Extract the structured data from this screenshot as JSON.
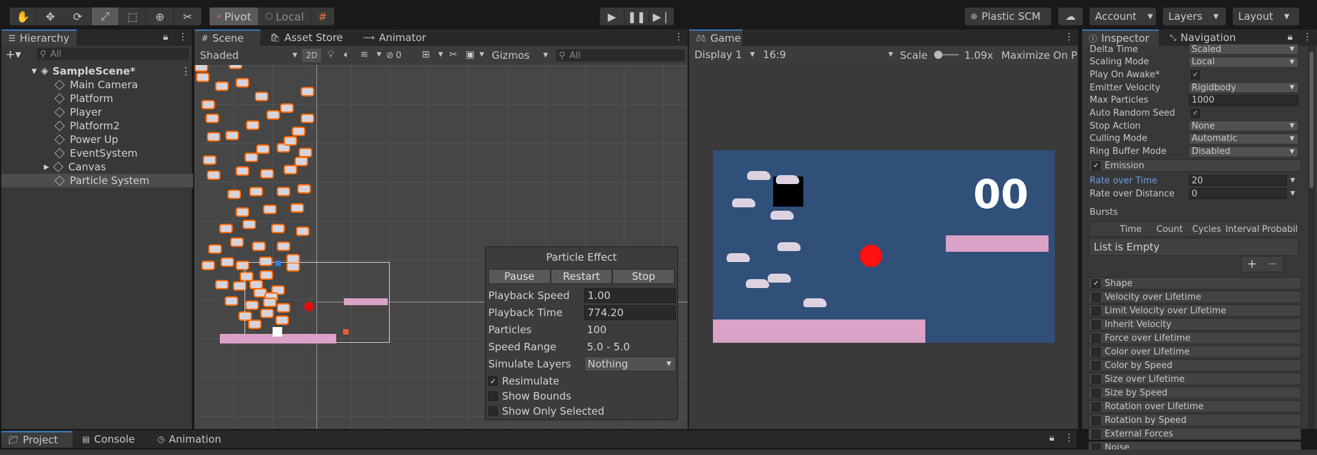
{
  "colors": {
    "accent": "#3a79bb",
    "orange": "#ff6a00",
    "pink": "#dba2c8",
    "game_bg": "#30507a",
    "red": "#ff1010"
  },
  "toolbar": {
    "tools": [
      "hand-icon",
      "move-icon",
      "rotate-icon",
      "scale-icon",
      "rect-icon",
      "transform-icon",
      "custom-tool-icon"
    ],
    "pivot_label": "Pivot",
    "local_label": "Local",
    "plastic_label": "Plastic SCM",
    "account_label": "Account",
    "layers_label": "Layers",
    "layout_label": "Layout"
  },
  "hierarchy": {
    "tab": "Hierarchy",
    "search_placeholder": "All",
    "scene_name": "SampleScene*",
    "items": [
      {
        "label": "Main Camera"
      },
      {
        "label": "Platform"
      },
      {
        "label": "Player"
      },
      {
        "label": "Platform2"
      },
      {
        "label": "Power Up"
      },
      {
        "label": "EventSystem"
      },
      {
        "label": "Canvas"
      },
      {
        "label": "Particle System"
      }
    ]
  },
  "scene": {
    "tabs": [
      "Scene",
      "Asset Store",
      "Animator"
    ],
    "shading": "Shaded",
    "mode_2d": "2D",
    "hidden_count": "0",
    "gizmos": "Gizmos",
    "search_placeholder": "All"
  },
  "particle_effect": {
    "title": "Particle Effect",
    "pause": "Pause",
    "restart": "Restart",
    "stop": "Stop",
    "playback_speed_label": "Playback Speed",
    "playback_speed": "1.00",
    "playback_time_label": "Playback Time",
    "playback_time": "774.20",
    "particles_label": "Particles",
    "particles": "100",
    "speed_range_label": "Speed Range",
    "speed_range": "5.0 - 5.0",
    "simulate_layers_label": "Simulate Layers",
    "simulate_layers": "Nothing",
    "resimulate": "Resimulate",
    "show_bounds": "Show Bounds",
    "show_only_selected": "Show Only Selected"
  },
  "game": {
    "tab": "Game",
    "display": "Display 1",
    "aspect": "16:9",
    "scale_label": "Scale",
    "scale_value": "1.09x",
    "maximize": "Maximize On Pl",
    "score": "00"
  },
  "inspector": {
    "tab": "Inspector",
    "nav_tab": "Navigation",
    "properties": [
      {
        "label": "Delta Time",
        "value": "Scaled",
        "kind": "drop"
      },
      {
        "label": "Scaling Mode",
        "value": "Local",
        "kind": "drop"
      },
      {
        "label": "Play On Awake*",
        "value": "✓",
        "kind": "check"
      },
      {
        "label": "Emitter Velocity",
        "value": "Rigidbody",
        "kind": "drop"
      },
      {
        "label": "Max Particles",
        "value": "1000",
        "kind": "field"
      },
      {
        "label": "Auto Random Seed",
        "value": "✓",
        "kind": "check"
      },
      {
        "label": "Stop Action",
        "value": "None",
        "kind": "drop"
      },
      {
        "label": "Culling Mode",
        "value": "Automatic",
        "kind": "drop"
      },
      {
        "label": "Ring Buffer Mode",
        "value": "Disabled",
        "kind": "drop"
      }
    ],
    "emission": "Emission",
    "rate_over_time_label": "Rate over Time",
    "rate_over_time": "20",
    "rate_over_distance_label": "Rate over Distance",
    "rate_over_distance": "0",
    "bursts_label": "Bursts",
    "burst_columns": [
      "Time",
      "Count",
      "Cycles",
      "Interval",
      "Probabil"
    ],
    "list_empty": "List is Empty",
    "modules": [
      {
        "label": "Shape",
        "checked": true
      },
      {
        "label": "Velocity over Lifetime",
        "checked": false
      },
      {
        "label": "Limit Velocity over Lifetime",
        "checked": false
      },
      {
        "label": "Inherit Velocity",
        "checked": false
      },
      {
        "label": "Force over Lifetime",
        "checked": false
      },
      {
        "label": "Color over Lifetime",
        "checked": false
      },
      {
        "label": "Color by Speed",
        "checked": false
      },
      {
        "label": "Size over Lifetime",
        "checked": false
      },
      {
        "label": "Size by Speed",
        "checked": false
      },
      {
        "label": "Rotation over Lifetime",
        "checked": false
      },
      {
        "label": "Rotation by Speed",
        "checked": false
      },
      {
        "label": "External Forces",
        "checked": false
      },
      {
        "label": "Noise",
        "checked": false
      }
    ]
  },
  "bottom": {
    "tabs": [
      "Project",
      "Console",
      "Animation"
    ]
  }
}
